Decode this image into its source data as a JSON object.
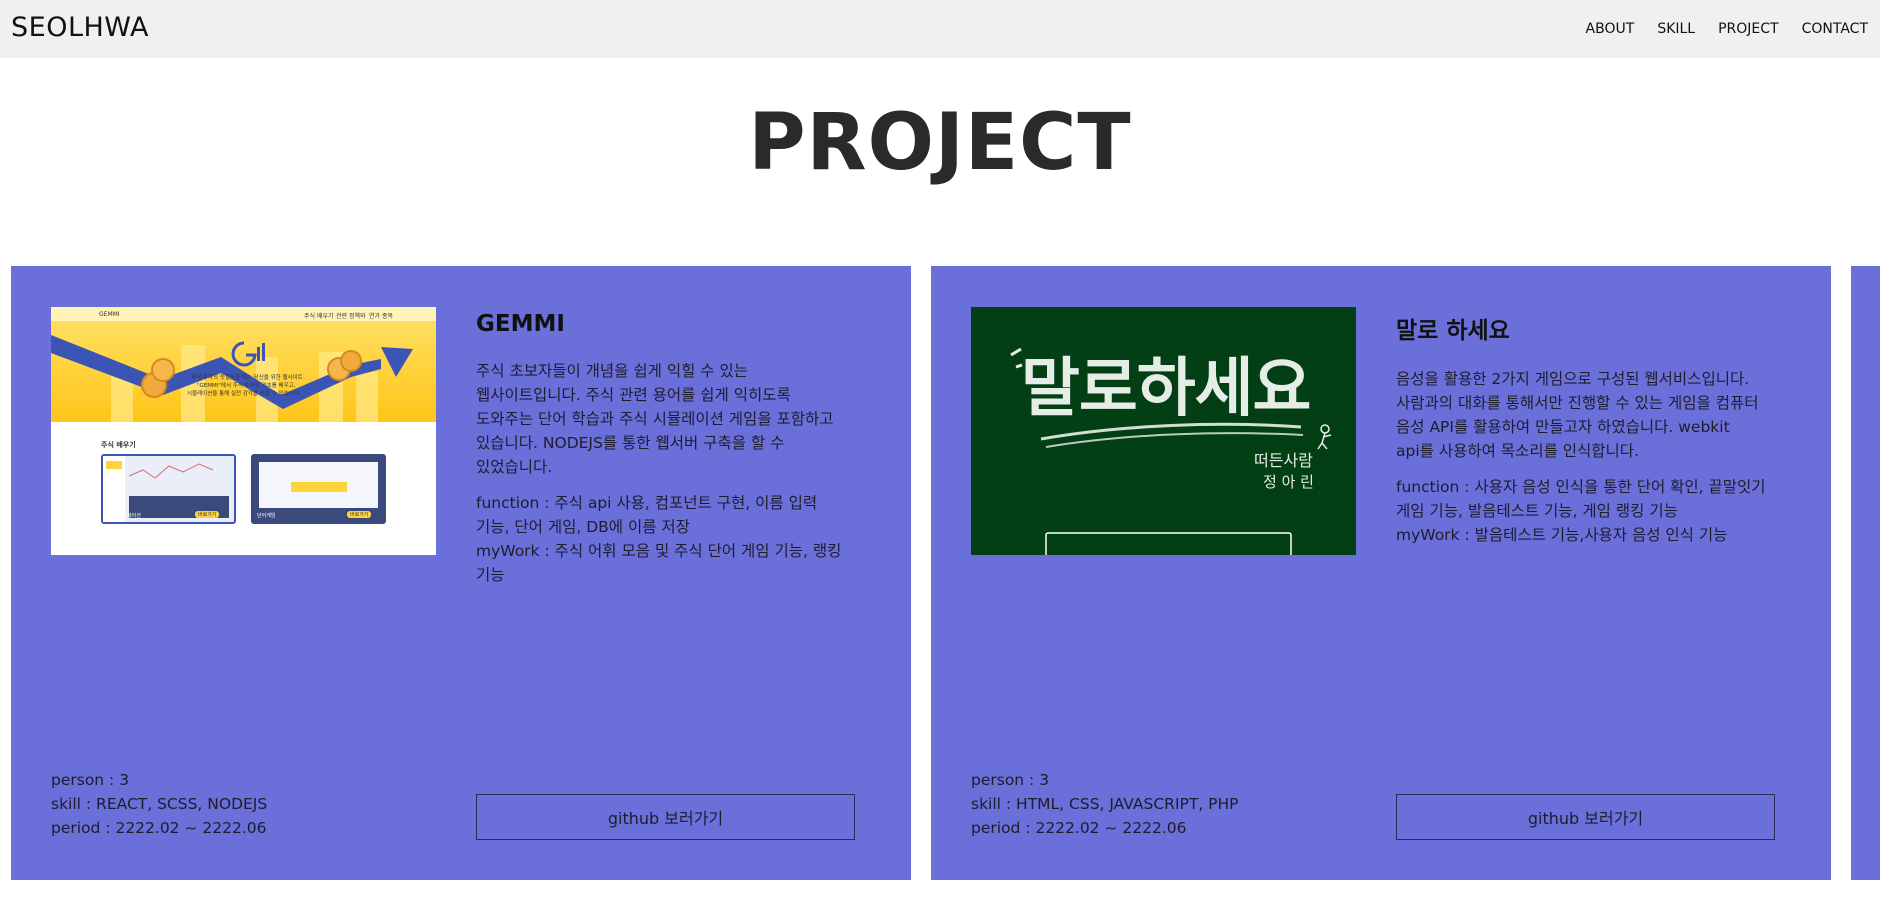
{
  "header": {
    "logo": "SEOLHWA",
    "nav": [
      "ABOUT",
      "SKILL",
      "PROJECT",
      "CONTACT"
    ]
  },
  "page": {
    "title": "PROJECT"
  },
  "projects": [
    {
      "title": "GEMMI",
      "description": "주식 초보자들이 개념을 쉽게 익힐 수 있는 웹사이트입니다. 주식 관련 용어를 쉽게 익히도록 도와주는 단어 학습과 주식 시뮬레이션 게임을 포함하고 있습니다. NODEJS를 통한 웹서버 구축을 할 수 있었습니다.",
      "function": "function : 주식 api 사용, 컴포넌트 구현, 이름 입력 기능, 단어 게임, DB에 이름 저장",
      "mywork": "myWork : 주식 어휘 모음 및 주식 단어 게임 기능, 랭킹 기능",
      "person": "person : 3",
      "skill": "skill : REACT, SCSS, NODEJS",
      "period": "period : 2222.02 ~ 2222.06",
      "button": "github 보러가기",
      "thumb_text": {
        "brand": "GEMMI",
        "nav": [
          "주식 배우기",
          "관련 정책와",
          "연가 종목"
        ],
        "intro_1": "주식 투자의 첫걸음을 떼는 당신을 위한 웹사이트",
        "intro_2": "\"GEMMI\"에서 주식 투자의 기초를 배우고,",
        "intro_3": "시뮬레이션을 통해 실전 감각을 키울 수 있습니다.",
        "section": "주식 배우기",
        "card_a": "주식 시뮬레이션",
        "card_b": "단어게임",
        "btn": "바로가기"
      }
    },
    {
      "title": "말로 하세요",
      "description": "음성을 활용한 2가지 게임으로 구성된 웹서비스입니다. 사람과의 대화를 통해서만 진행할 수 있는 게임을 컴퓨터 음성 API를 활용하여 만들고자 하였습니다. webkit api를 사용하여 목소리를 인식합니다.",
      "function": "function : 사용자 음성 인식을 통한 단어 확인, 끝말잇기 게임 기능, 발음테스트 기능, 게임 랭킹 기능",
      "mywork": "myWork : 발음테스트 기능,사용자 음성 인식 기능",
      "person": "person : 3",
      "skill": "skill : HTML, CSS, JAVASCRIPT, PHP",
      "period": "period : 2222.02 ~ 2222.06",
      "button": "github 보러가기",
      "thumb_text": {
        "headline": "말로하세요",
        "sub_1": "떠든사람",
        "sub_2": "정 아 린"
      }
    }
  ],
  "colors": {
    "card_bg": "#6b6fd9",
    "header_bg": "#f0f0f0",
    "chalkboard": "#033f14",
    "gemmi_yellow": "#ffcf2a",
    "gemmi_blue": "#3a55b5"
  }
}
